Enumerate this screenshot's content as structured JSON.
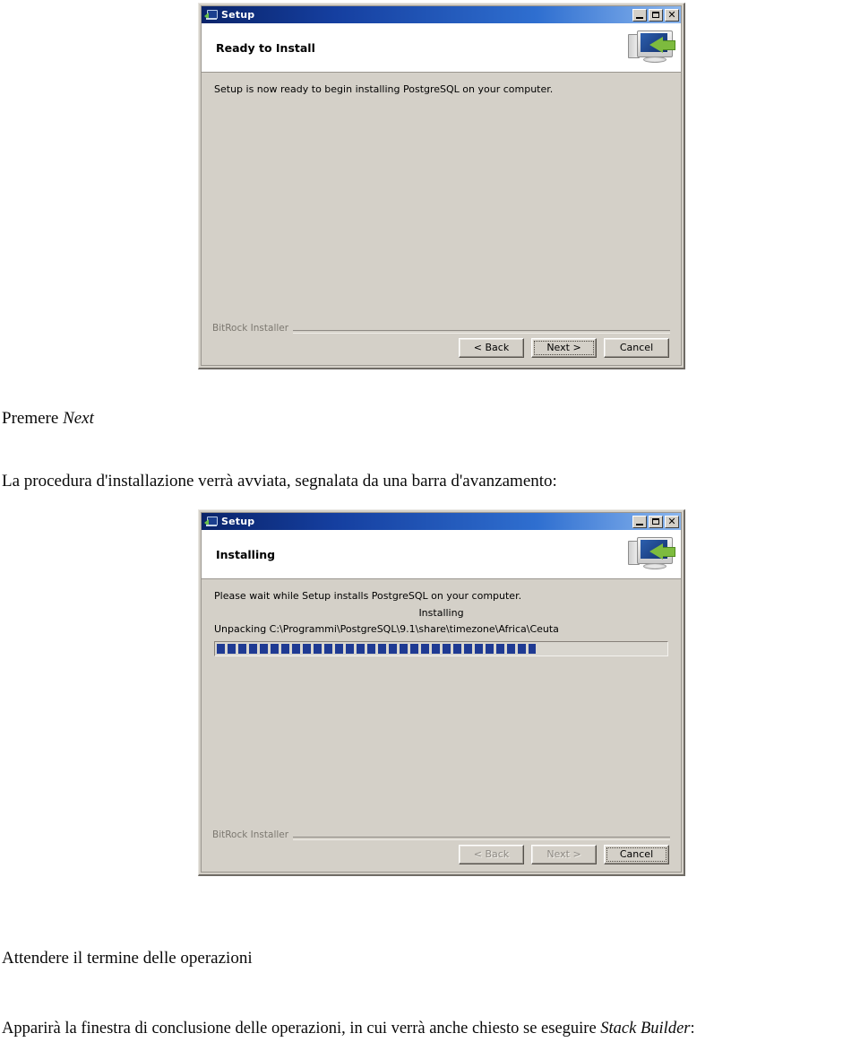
{
  "document": {
    "paragraphs": {
      "premere": {
        "prefix": "Premere ",
        "emphasis": "Next"
      },
      "procedura": "La procedura d'installazione verrà avviata, segnalata da una barra d'avanzamento:",
      "attendere": "Attendere il termine delle operazioni",
      "apparira": {
        "prefix": "Apparirà la finestra di conclusione delle operazioni, in cui verrà anche chiesto se eseguire ",
        "emphasis": "Stack Builder",
        "suffix": ":"
      }
    }
  },
  "dialog_ready": {
    "titlebar": {
      "title": "Setup",
      "icon": "setup-icon",
      "minimize_label": "Minimize",
      "maximize_label": "Maximize",
      "close_label": "✕"
    },
    "header": {
      "title": "Ready to Install",
      "icon": "computer-install-icon"
    },
    "body": {
      "message": "Setup is now ready to begin installing PostgreSQL on your computer."
    },
    "footer": {
      "brand": "BitRock Installer",
      "buttons": [
        {
          "label": "< Back",
          "name": "back-button",
          "state": "enabled"
        },
        {
          "label": "Next >",
          "name": "next-button",
          "state": "focused"
        },
        {
          "label": "Cancel",
          "name": "cancel-button",
          "state": "enabled"
        }
      ]
    }
  },
  "dialog_installing": {
    "titlebar": {
      "title": "Setup",
      "icon": "setup-icon",
      "minimize_label": "Minimize",
      "maximize_label": "Maximize",
      "close_label": "✕"
    },
    "header": {
      "title": "Installing",
      "icon": "computer-install-icon"
    },
    "body": {
      "message": "Please wait while Setup installs PostgreSQL on your computer.",
      "status": "Installing",
      "current_file": "Unpacking C:\\Programmi\\PostgreSQL\\9.1\\share\\timezone\\Africa\\Ceuta",
      "progress_percent": 71
    },
    "footer": {
      "brand": "BitRock Installer",
      "buttons": [
        {
          "label": "< Back",
          "name": "back-button",
          "state": "disabled"
        },
        {
          "label": "Next >",
          "name": "next-button",
          "state": "disabled"
        },
        {
          "label": "Cancel",
          "name": "cancel-button",
          "state": "focused"
        }
      ]
    }
  },
  "colors": {
    "dialog_face": "#d4d0c8",
    "titlebar_start": "#0a246a",
    "titlebar_end": "#8ab6ee",
    "progress_fill": "#1f3a93",
    "accent_green": "#7dbb3e"
  }
}
